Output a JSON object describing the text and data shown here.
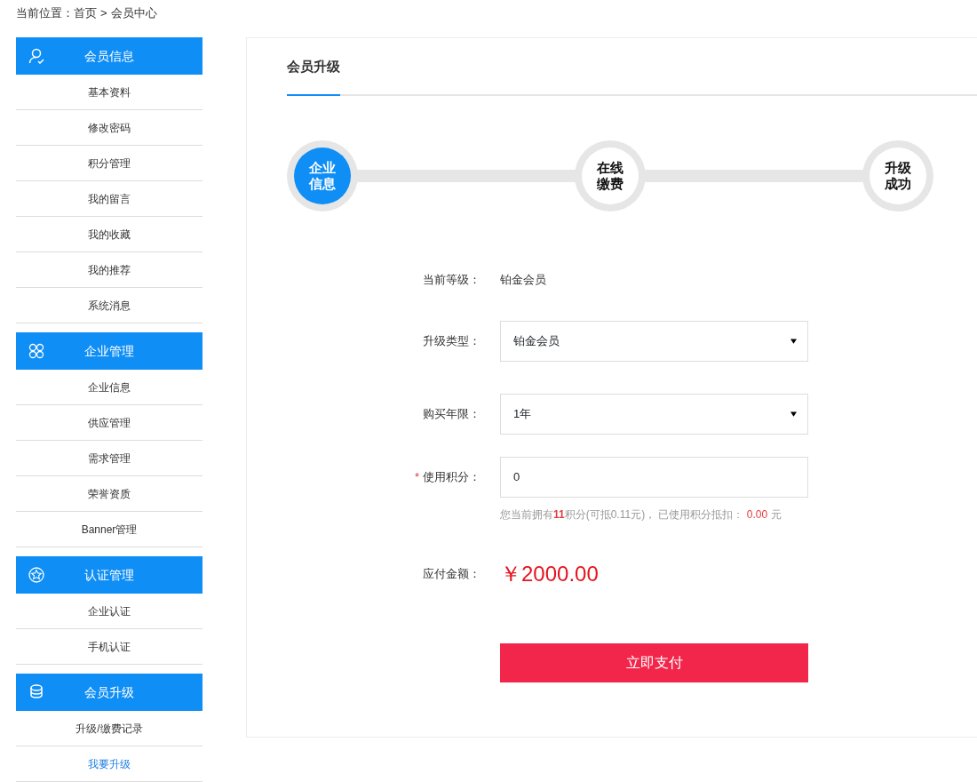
{
  "breadcrumb": {
    "label": "当前位置：",
    "links": [
      "首页",
      "会员中心"
    ],
    "separator": ">"
  },
  "sidebar": [
    {
      "title": "会员信息",
      "items": [
        {
          "label": "基本资料",
          "selected": false
        },
        {
          "label": "修改密码",
          "selected": false
        },
        {
          "label": "积分管理",
          "selected": false
        },
        {
          "label": "我的留言",
          "selected": false
        },
        {
          "label": "我的收藏",
          "selected": false
        },
        {
          "label": "我的推荐",
          "selected": false
        },
        {
          "label": "系统消息",
          "selected": false
        }
      ]
    },
    {
      "title": "企业管理",
      "items": [
        {
          "label": "企业信息",
          "selected": false
        },
        {
          "label": "供应管理",
          "selected": false
        },
        {
          "label": "需求管理",
          "selected": false
        },
        {
          "label": "荣誉资质",
          "selected": false
        },
        {
          "label": "Banner管理",
          "selected": false
        }
      ]
    },
    {
      "title": "认证管理",
      "items": [
        {
          "label": "企业认证",
          "selected": false
        },
        {
          "label": "手机认证",
          "selected": false
        }
      ]
    },
    {
      "title": "会员升级",
      "items": [
        {
          "label": "升级/缴费记录",
          "selected": false
        },
        {
          "label": "我要升级",
          "selected": true
        }
      ]
    }
  ],
  "main": {
    "tab": "会员升级",
    "steps": [
      {
        "label": "企业信息",
        "selected": true
      },
      {
        "label": "在线缴费",
        "selected": false
      },
      {
        "label": "升级成功",
        "selected": false
      }
    ],
    "form": [
      {
        "kind": "text",
        "label": "当前等级：",
        "value": "铂金会员"
      },
      {
        "kind": "select",
        "label": "升级类型：",
        "value": "铂金会员"
      },
      {
        "kind": "select",
        "label": "购买年限：",
        "value": "1年"
      },
      {
        "kind": "input",
        "required_mark": "*",
        "label": "使用积分：",
        "value": "0",
        "hint": [
          {
            "text": "您当前拥有",
            "kind": "plain"
          },
          {
            "text": "11",
            "kind": "count"
          },
          {
            "text": "积分(可抵0.11元)， 已使用积分抵扣： ",
            "kind": "plain"
          },
          {
            "text": "0.00",
            "kind": "amount"
          },
          {
            "text": " 元",
            "kind": "plain"
          }
        ]
      },
      {
        "kind": "amount",
        "label": "应付金额：",
        "value": "￥2000.00"
      }
    ],
    "submit": "立即支付"
  }
}
